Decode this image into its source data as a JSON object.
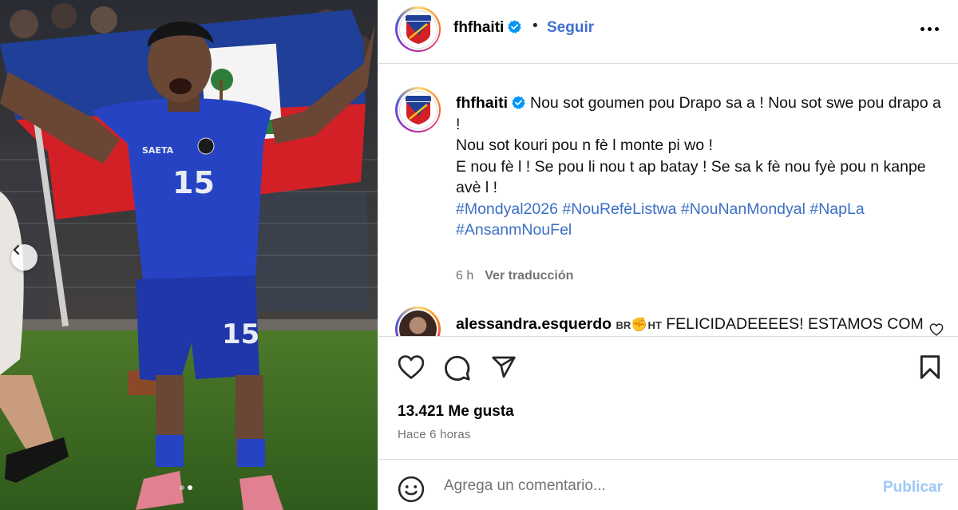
{
  "post": {
    "username": "fhfhaiti",
    "separator": "•",
    "follow_label": "Seguir",
    "caption_lines": [
      "Nou sot goumen pou Drapo sa a ! Nou sot swe pou drapo a !",
      "Nou sot kouri pou n fè l monte pi wo !",
      "E nou fè l ! Se pou li nou t ap batay ! Se sa k fè nou fyè pou n kanpe avè l !"
    ],
    "hashtags": "#Mondyal2026 #NouRefèListwa #NouNanMondyal #NapLa #AnsanmNouFel",
    "age": "6 h",
    "translate_label": "Ver traducción",
    "likes": "13.421 Me gusta",
    "time_ago": "Hace 6 horas"
  },
  "comment": {
    "username": "alessandra.esquerdo",
    "flag_a": "BR",
    "flag_b": "HT",
    "text": "FELICIDADEEEES! ESTAMOS COM"
  },
  "add_comment": {
    "placeholder": "Agrega un comentario...",
    "publish_label": "Publicar"
  },
  "photo": {
    "jersey_number": "15",
    "sponsor": "SAETA",
    "carousel": {
      "index": 2,
      "total": 2
    }
  },
  "icons": {
    "more": "more-icon",
    "heart": "heart-icon",
    "comment": "comment-icon",
    "share": "share-icon",
    "save": "bookmark-icon",
    "emoji": "emoji-icon",
    "verified": "verified-icon",
    "prev": "chevron-left-icon"
  },
  "colors": {
    "accent": "#0095f6",
    "link": "#3c6fc4",
    "verified": "#0095f6",
    "muted": "#737373"
  }
}
